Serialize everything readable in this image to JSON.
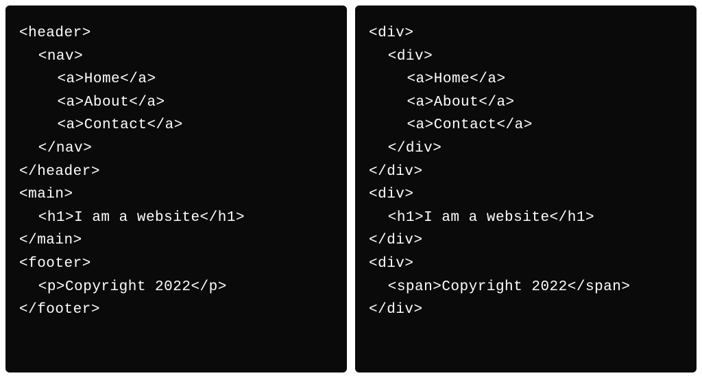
{
  "left": {
    "lines": [
      {
        "text": "<header>",
        "indent": 0
      },
      {
        "text": "<nav>",
        "indent": 1
      },
      {
        "text": "<a>Home</a>",
        "indent": 2
      },
      {
        "text": "<a>About</a>",
        "indent": 2
      },
      {
        "text": "<a>Contact</a>",
        "indent": 2
      },
      {
        "text": "</nav>",
        "indent": 1
      },
      {
        "text": "</header>",
        "indent": 0
      },
      {
        "text": "<main>",
        "indent": 0
      },
      {
        "text": "<h1>I am a website</h1>",
        "indent": 1
      },
      {
        "text": "</main>",
        "indent": 0
      },
      {
        "text": "<footer>",
        "indent": 0
      },
      {
        "text": "<p>Copyright 2022</p>",
        "indent": 1
      },
      {
        "text": "</footer>",
        "indent": 0
      }
    ]
  },
  "right": {
    "lines": [
      {
        "text": "<div>",
        "indent": 0
      },
      {
        "text": "<div>",
        "indent": 1
      },
      {
        "text": "<a>Home</a>",
        "indent": 2
      },
      {
        "text": "<a>About</a>",
        "indent": 2
      },
      {
        "text": "<a>Contact</a>",
        "indent": 2
      },
      {
        "text": "</div>",
        "indent": 1
      },
      {
        "text": "</div>",
        "indent": 0
      },
      {
        "text": "<div>",
        "indent": 0
      },
      {
        "text": "<h1>I am a website</h1>",
        "indent": 1
      },
      {
        "text": "</div>",
        "indent": 0
      },
      {
        "text": "<div>",
        "indent": 0
      },
      {
        "text": "<span>Copyright 2022</span>",
        "indent": 1
      },
      {
        "text": "</div>",
        "indent": 0
      }
    ]
  }
}
